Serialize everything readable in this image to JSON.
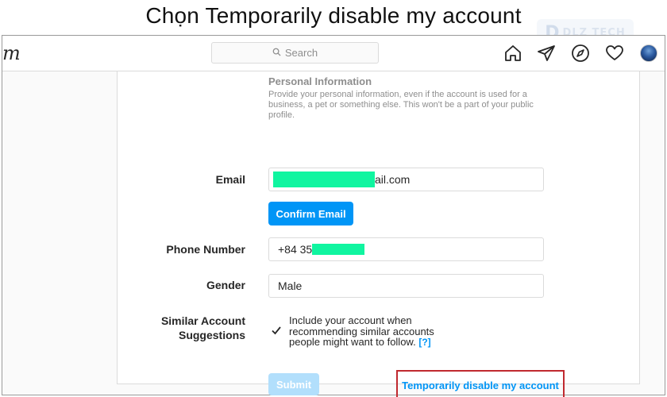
{
  "caption": "Chọn Temporarily disable my account",
  "watermark": {
    "letter": "D",
    "text": "DLZ TECH"
  },
  "navbar": {
    "logo_fragment": "m",
    "search_placeholder": "Search",
    "icons": [
      "home-icon",
      "direct-messages-icon",
      "explore-compass-icon",
      "activity-heart-icon",
      "profile-avatar"
    ]
  },
  "personal_info": {
    "title": "Personal Information",
    "description": "Provide your personal information, even if the account is used for a business, a pet or something else. This won't be a part of your public profile."
  },
  "form": {
    "email_label": "Email",
    "email_visible_suffix": "ail.com",
    "confirm_email_label": "Confirm Email",
    "phone_label": "Phone Number",
    "phone_visible_prefix": "+84 35",
    "gender_label": "Gender",
    "gender_value": "Male",
    "similar_label_line1": "Similar Account",
    "similar_label_line2": "Suggestions",
    "similar_checked": true,
    "similar_text": "Include your account when recommending similar accounts people might want to follow.",
    "help_link": "[?]",
    "submit_label": "Submit",
    "disable_link": "Temporarily disable my account"
  },
  "colors": {
    "accent": "#0095f6",
    "redaction": "#10f5a0",
    "highlight_box": "#c0292f",
    "submit_disabled": "#b2dffc"
  }
}
